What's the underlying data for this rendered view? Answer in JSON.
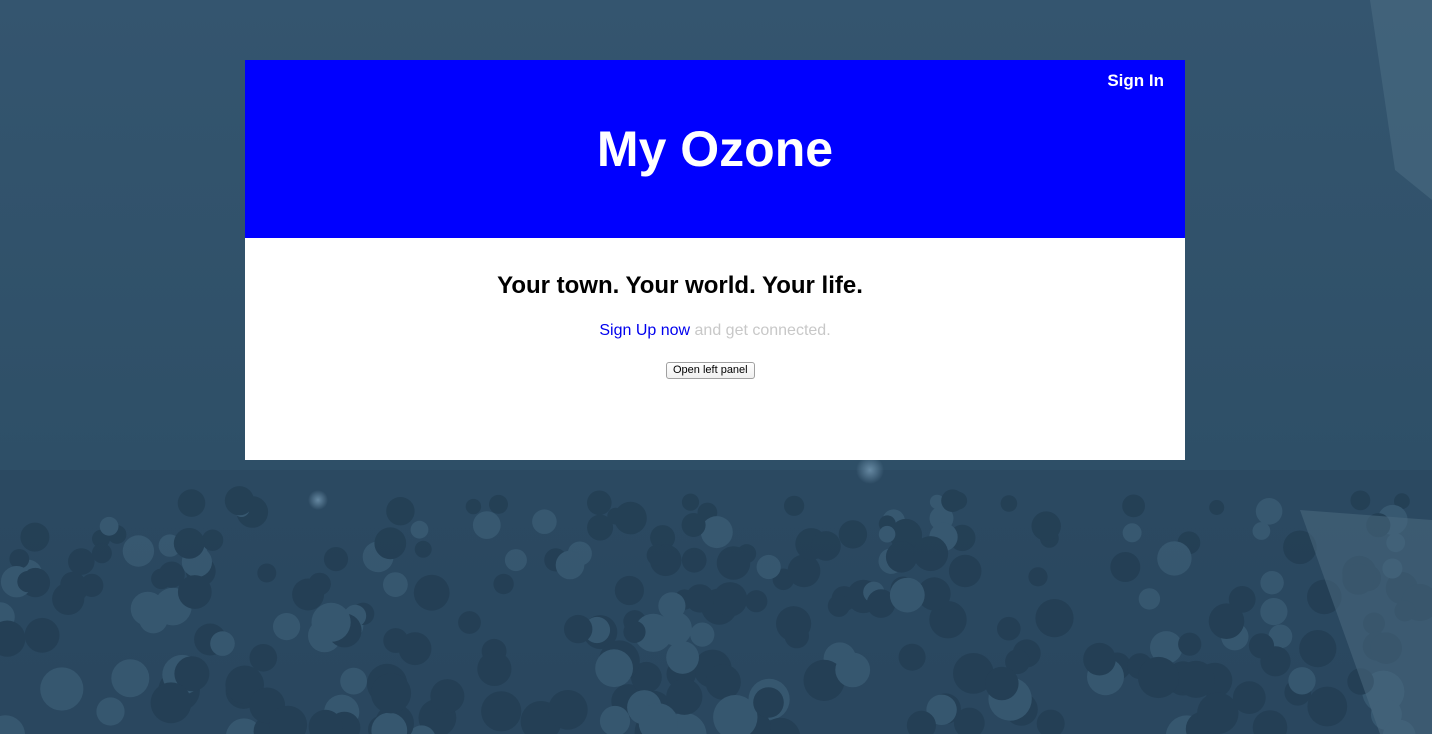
{
  "header": {
    "sign_in_label": "Sign In",
    "site_title": "My Ozone"
  },
  "main": {
    "tagline": "Your town. Your world. Your life.",
    "signup_link": "Sign Up now",
    "signup_rest": " and get connected.",
    "panel_button_label": "Open left panel"
  },
  "colors": {
    "header_bg": "#0000ff",
    "card_bg": "#ffffff",
    "page_bg": "#2f5068",
    "link": "#0000ee",
    "muted_text": "#c8c8c8"
  }
}
